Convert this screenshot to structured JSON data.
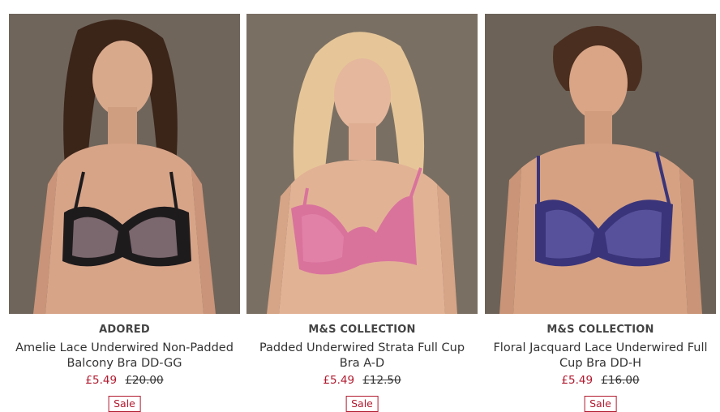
{
  "products": [
    {
      "brand": "ADORED",
      "title": "Amelie Lace Underwired Non-Padded Balcony Bra DD-GG",
      "price_now": "£5.49",
      "price_was": "£20.00",
      "badge": "Sale",
      "image_alt": "Model wearing black and pink lace balcony bra",
      "colors": {
        "bg": "#6f655b",
        "hair": "#3b2418",
        "bra": "#1e1b1d",
        "lace": "#c9a6b0"
      }
    },
    {
      "brand": "M&S COLLECTION",
      "title": "Padded Underwired Strata Full Cup Bra A-D",
      "price_now": "£5.49",
      "price_was": "£12.50",
      "badge": "Sale",
      "image_alt": "Model wearing pink padded full cup bra",
      "colors": {
        "bg": "#7a6f63",
        "hair": "#e6c698",
        "bra": "#d9739c",
        "lace": "#e68bb0"
      }
    },
    {
      "brand": "M&S COLLECTION",
      "title": "Floral Jacquard Lace Underwired Full Cup Bra DD-H",
      "price_now": "£5.49",
      "price_was": "£16.00",
      "badge": "Sale",
      "image_alt": "Model wearing purple floral jacquard lace bra",
      "colors": {
        "bg": "#6c6258",
        "hair": "#4a2e1f",
        "bra": "#3a357a",
        "lace": "#6b64b0"
      }
    }
  ]
}
